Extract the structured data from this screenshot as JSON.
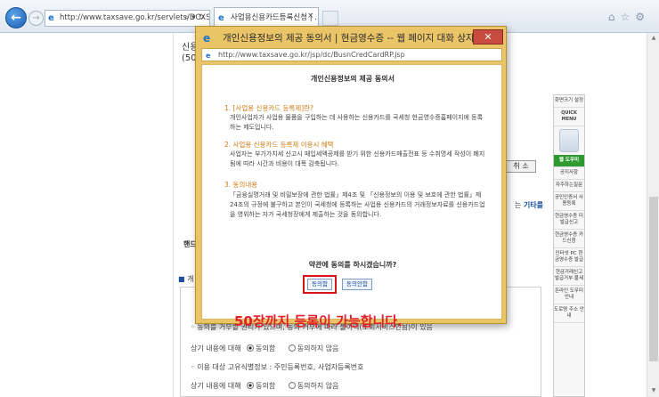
{
  "browser": {
    "address_url": "http://www.taxsave.go.kr/servlets/DCXSen",
    "tab_title": "사업용신용카드등록신청 | ...",
    "tab_close": "×"
  },
  "background": {
    "label_top": "신용\n(50",
    "cancel_label": "취 소",
    "other_text": "는 ",
    "other_link": "기타를",
    "hint_text": "핸드",
    "section_label": "개",
    "line_refuse": "◦ 동의를 거부할 권리가 있으며, 동의 거부에 따라 불이익(조회서비스안됨)이 있음",
    "line_agree_prefix_1": "상기 내용에 대해",
    "radio_agree": "동의함",
    "radio_disagree": "동의하지 않음",
    "line_items": "◦ 이용 대상 고유식별정보 : 주민등록번호, 사업자등록번호",
    "line_agree_prefix_2": "상기 내용에 대해"
  },
  "quick_menu": {
    "size_setting": "화면크기 설정",
    "header": "QUICK MENU",
    "active": "웹 도우미",
    "items": [
      "공지사항",
      "자주하는질문",
      "공인인증서 사용등록",
      "현금영수증 미발급신고",
      "현금영수증 카드신청",
      "인터넷 PC 현금영수증 발급",
      "현금거래신고 발급거부·불세",
      "온라인 도우미 안내",
      "도로명 주소 안내"
    ]
  },
  "dialog": {
    "title": "개인신용정보의 제공 동의서 | 현금영수증 -- 웹 페이지 대화 상자",
    "close_label": "✕",
    "url": "http://www.taxsave.go.kr/jsp/dc/BusnCredCardRP.jsp",
    "consent_title": "개인신용정보의 제공 동의서",
    "sections": [
      {
        "heading": "1. [사업용 신용카드 등록제]란?",
        "body": "개인사업자가 사업용 물품을 구입하는 데 사용하는 신용카드를 국세청 현금영수증홈페이지에 등록하는 제도입니다."
      },
      {
        "heading": "2. 사업용 신용카드 등록제 이용시 혜택",
        "body": "사업자는 부가가치세 신고시 매입세액공제를 받기 위한 신용카드매출전표 등 수취명세 작성이 폐지됨에 따라 시간과 비용이 대폭 감축됩니다."
      },
      {
        "heading": "3. 동의내용",
        "body": "「금융실명거래 및 비밀보장에 관한 법률」제4조 및 「신용정보의 이용 및 보호에 관한 법률」제24조의 규정에 불구하고 본인이 국세청에 등록하는 사업용 신용카드의 거래정보자료를 신용카드업을 영위하는 자가 국세청장에게 제출하는 것을 동의합니다."
      }
    ],
    "question": "약관에 동의를 하시겠습니까?",
    "agree_label": "동의함",
    "decline_label": "동의안함",
    "note": "50장까지 등록이 가능합니다."
  }
}
